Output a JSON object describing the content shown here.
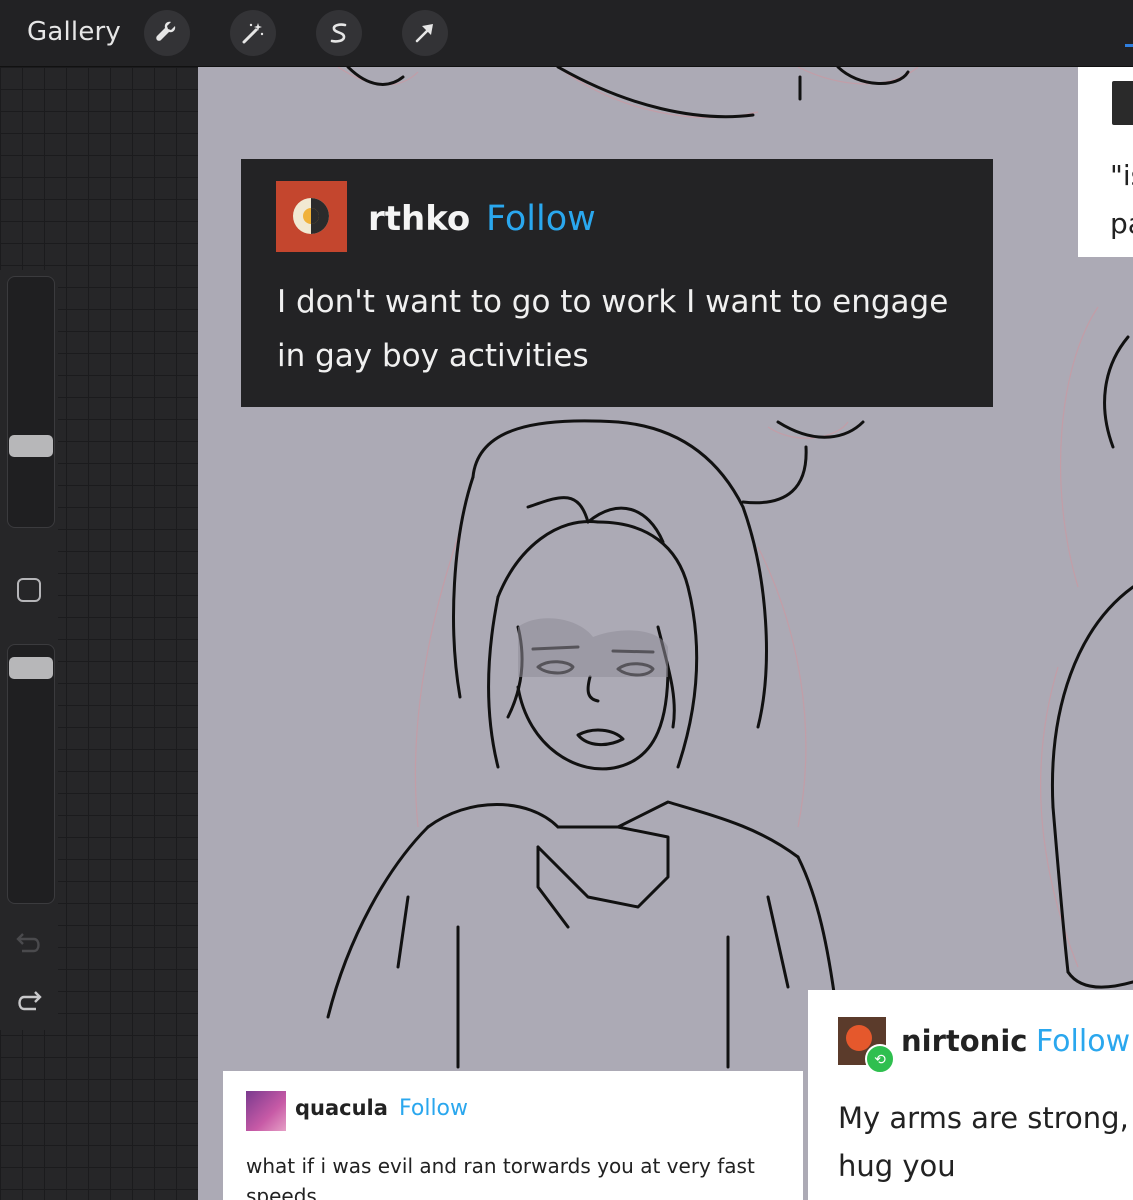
{
  "toolbar": {
    "gallery_label": "Gallery",
    "tools": [
      "wrench-icon",
      "magic-wand-icon",
      "selection-s-icon",
      "transform-arrow-icon"
    ]
  },
  "sidebar": {
    "brush_size_level": 0.66,
    "opacity_level": 0.0,
    "icons": [
      "modify-square-icon",
      "undo-icon",
      "redo-icon"
    ]
  },
  "posts": {
    "rthko": {
      "username": "rthko",
      "follow_label": "Follow",
      "text": "I don't want to go to work I want to engage in gay boy activities"
    },
    "topright": {
      "line1": "\"is",
      "line2": "pa"
    },
    "quacula": {
      "username": "quacula",
      "follow_label": "Follow",
      "text": "what if i was evil and ran torwards you at very fast speeds"
    },
    "nirtonic": {
      "username": "nirtonic",
      "follow_label": "Follow",
      "text": "My arms are strong, hug you"
    }
  },
  "colors": {
    "canvas": "#acaab5",
    "follow_blue": "#2aa7ee",
    "dark_post": "#232325",
    "reblog_green": "#2fbf4f"
  }
}
